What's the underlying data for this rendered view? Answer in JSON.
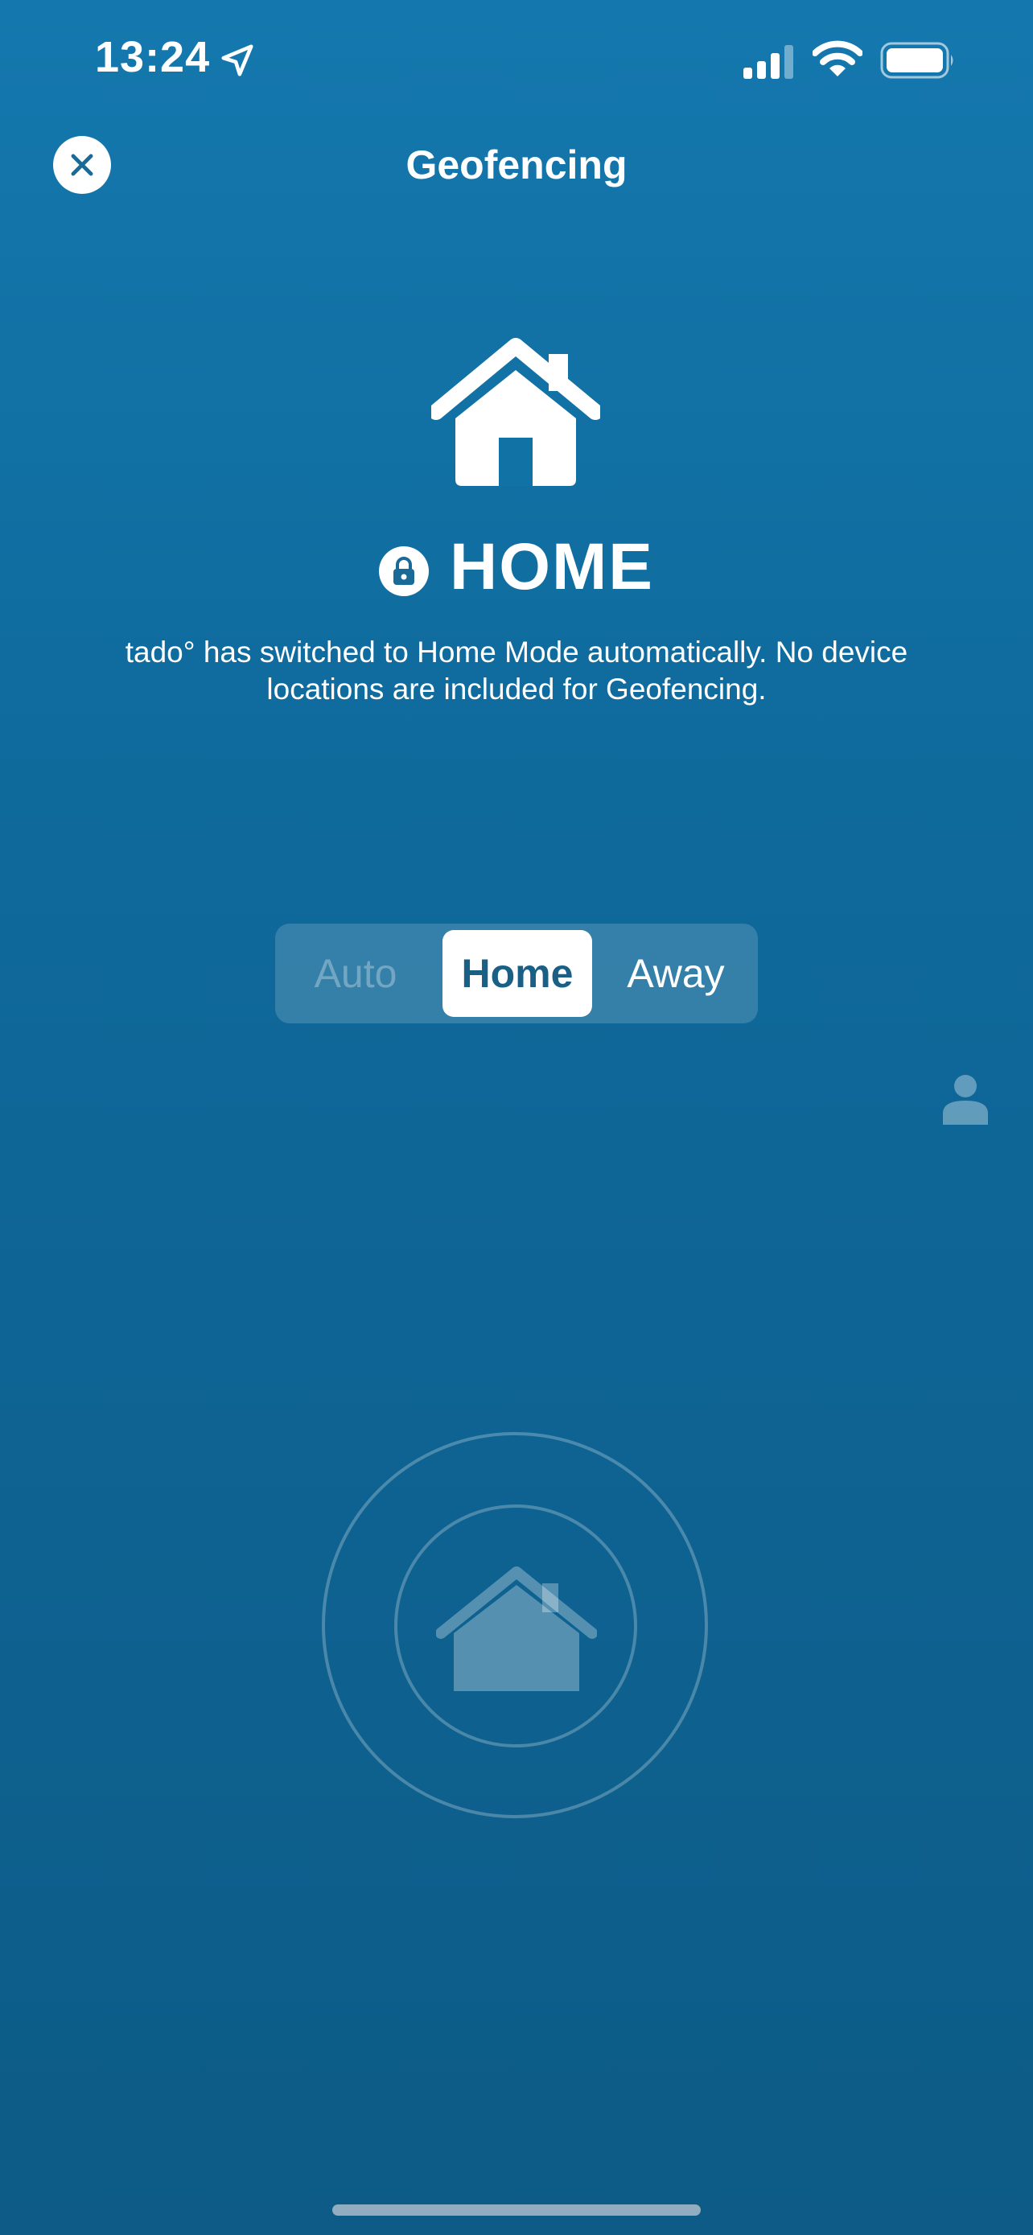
{
  "status_bar": {
    "time": "13:24"
  },
  "header": {
    "title": "Geofencing",
    "close_icon": "close-icon"
  },
  "mode": {
    "label": "HOME",
    "description": "tado° has switched to Home Mode automatically. No device locations are included for Geofencing."
  },
  "segmented_control": {
    "options": [
      "Auto",
      "Home",
      "Away"
    ],
    "selected": "Home"
  },
  "colors": {
    "background_top": "#1478ae",
    "background_bottom": "#0d5b86",
    "selected_text": "#1a5f86"
  }
}
